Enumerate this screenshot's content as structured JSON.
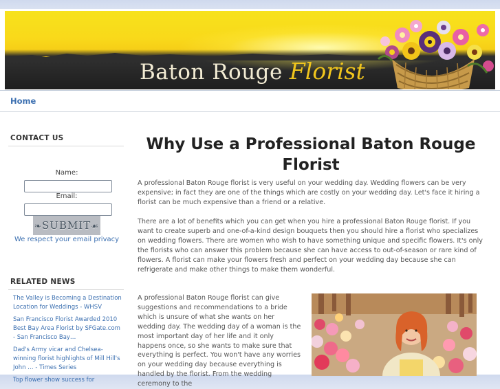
{
  "header": {
    "title_part1": "Baton Rouge",
    "title_part2": "Florist"
  },
  "nav": {
    "home_label": "Home"
  },
  "sidebar": {
    "contact_heading": "CONTACT US",
    "name_label": "Name:",
    "email_label": "Email:",
    "submit_label": "SUBMIT",
    "privacy_text": "We respect your email privacy",
    "news_heading": "RELATED NEWS",
    "news_items": [
      "The Valley is Becoming a Destination Location for Weddings - WHSV",
      "San Francisco Florist Awarded 2010 Best Bay Area Florist by SFGate.com - San Francisco Bay…",
      "Dad's Army vicar and Chelsea-winning florist highlights of Mill Hill's John … - Times Series",
      "Top flower show success for"
    ]
  },
  "main": {
    "title": "Why Use a Professional Baton Rouge Florist",
    "paragraph1": "A professional Baton Rouge florist is very useful on your wedding day. Wedding flowers can be very expensive; in fact they are one of the things which are costly on your wedding day. Let's face it hiring a florist can be much expensive than a friend or a relative.",
    "paragraph2": "There are a lot of benefits which you can get when you hire a professional Baton Rouge florist. If you want to create superb and one-of-a-kind design bouquets then you should hire a florist who specializes on wedding flowers. There are women who wish to have something unique and specific flowers. It's only the florists who can answer this problem because she can have access to out-of-season or rare kind of flowers. A florist can make your flowers fresh and perfect on your wedding day because she can refrigerate and make other things to make them wonderful.",
    "paragraph3": "A professional Baton Rouge florist can give suggestions and recommendations to a bride which is unsure of what she wants on her wedding day. The wedding day of a woman is the most important day of her life and it only happens once, so she wants to make sure that everything is perfect. You won't have any worries on your wedding day because everything is handled by the florist. From the wedding ceremony to the"
  },
  "colors": {
    "link": "#3b6fb0",
    "banner_yellow": "#f7e21c",
    "banner_dark": "#2a2a2a",
    "title_gold": "#f0c51d"
  }
}
